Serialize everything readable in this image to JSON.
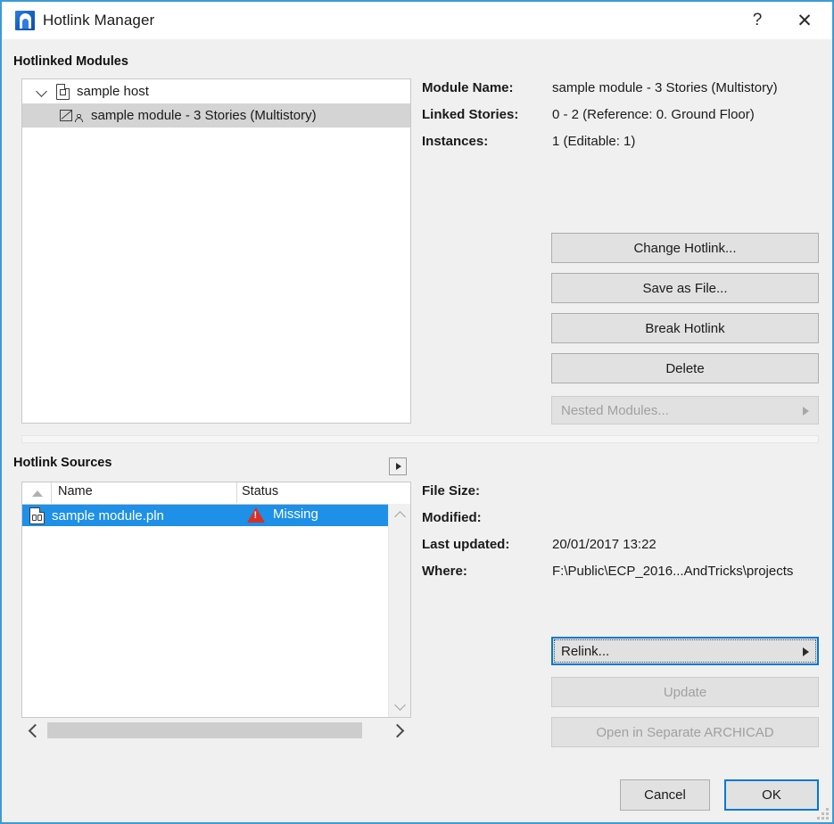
{
  "window": {
    "title": "Hotlink Manager",
    "app_icon": "archicad-logo-icon",
    "help_label": "?",
    "close_label": "✕"
  },
  "modules_section": {
    "label": "Hotlinked Modules",
    "tree": [
      {
        "label": "sample host",
        "icon": "document-icon",
        "expanded": true,
        "selected": false,
        "expander": "chevron-down-icon"
      },
      {
        "label": "sample module - 3 Stories (Multistory)",
        "icon": "hotlinked-module-icon",
        "expanded": false,
        "selected": true
      }
    ],
    "details": [
      {
        "key": "Module Name:",
        "value": "sample module - 3 Stories (Multistory)"
      },
      {
        "key": "Linked Stories:",
        "value": "0 - 2 (Reference: 0. Ground Floor)"
      },
      {
        "key": "Instances:",
        "value": "1 (Editable: 1)"
      }
    ],
    "buttons": {
      "change_hotlink": "Change Hotlink...",
      "save_as_file": "Save as File...",
      "break_hotlink": "Break Hotlink",
      "delete": "Delete",
      "nested_modules": "Nested Modules..."
    }
  },
  "sources_section": {
    "label": "Hotlink Sources",
    "popup_button_icon": "triangle-right-icon",
    "columns": [
      "Name",
      "Status"
    ],
    "sort_indicator": "sort-ascending-icon",
    "rows": [
      {
        "name": "sample module.pln",
        "status": "Missing",
        "status_icon": "warning-icon",
        "file_icon": "pln-file-icon",
        "selected": true
      }
    ],
    "details": [
      {
        "key": "File Size:",
        "value": ""
      },
      {
        "key": "Modified:",
        "value": ""
      },
      {
        "key": "Last updated:",
        "value": "20/01/2017 13:22"
      },
      {
        "key": "Where:",
        "value": "F:\\Public\\ECP_2016...AndTricks\\projects"
      }
    ],
    "buttons": {
      "relink": "Relink...",
      "update": "Update",
      "open_separate": "Open in Separate ARCHICAD"
    }
  },
  "footer": {
    "cancel": "Cancel",
    "ok": "OK"
  },
  "colors": {
    "window_border": "#3d9ad4",
    "selection": "#1e90e8",
    "focus": "#0078d7",
    "warning": "#d93025",
    "dialog_bg": "#f0f0f0"
  }
}
